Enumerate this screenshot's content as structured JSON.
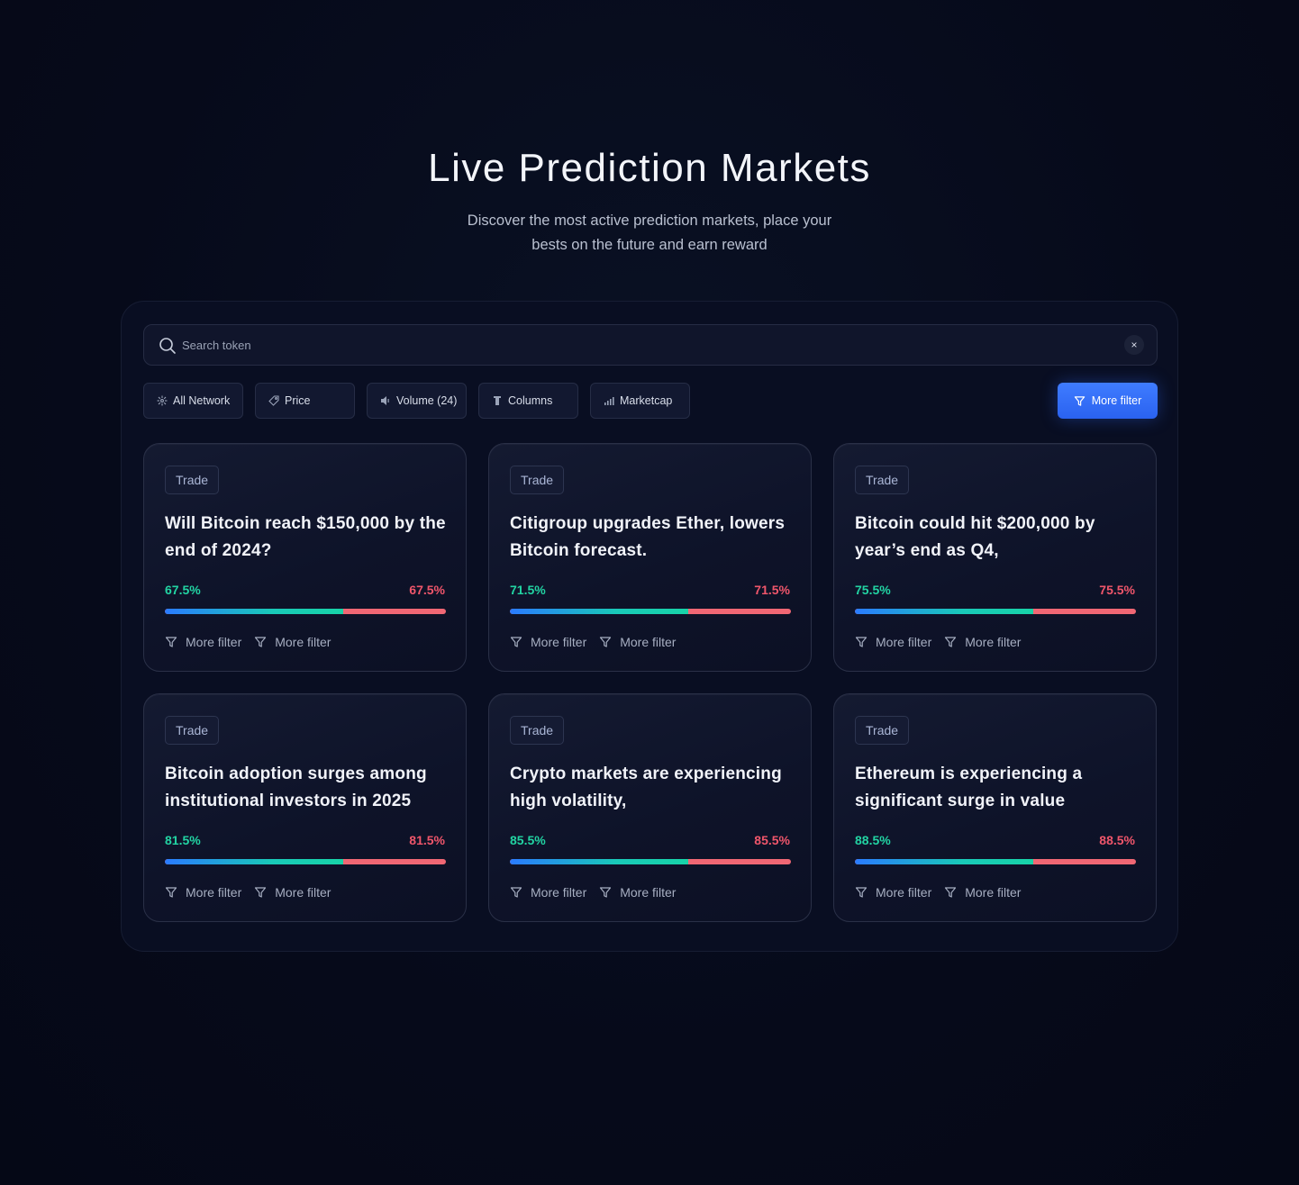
{
  "hero": {
    "title": "Live Prediction Markets",
    "subtitle_line1": "Discover the most active prediction markets, place your",
    "subtitle_line2": "bests on the future and earn reward"
  },
  "search": {
    "placeholder": "Search token",
    "value": "",
    "clear_label": "×"
  },
  "filters": {
    "chips": [
      {
        "label": "All Network",
        "icon": "network-icon"
      },
      {
        "label": "Price",
        "icon": "price-tag-icon"
      },
      {
        "label": "Volume (24)",
        "icon": "volume-icon"
      },
      {
        "label": "Columns",
        "icon": "columns-icon"
      },
      {
        "label": "Marketcap",
        "icon": "bar-chart-icon"
      }
    ],
    "more_filter": {
      "label": "More filter",
      "icon": "filter-icon"
    }
  },
  "colors": {
    "accent": "#2f6bff",
    "yes": "#22d4a3",
    "no": "#f0566b",
    "background": "#060a1a"
  },
  "cards": [
    {
      "badge": "Trade",
      "title": "Will Bitcoin reach $150,000 by the end of 2024?",
      "yes_pct": "67.5%",
      "no_pct": "67.5%",
      "fill": 0.635,
      "action1": "More filter",
      "action2": "More filter"
    },
    {
      "badge": "Trade",
      "title": "Citigroup upgrades Ether, lowers Bitcoin forecast.",
      "yes_pct": "71.5%",
      "no_pct": "71.5%",
      "fill": 0.635,
      "action1": "More filter",
      "action2": "More filter"
    },
    {
      "badge": "Trade",
      "title": "Bitcoin could hit $200,000 by year’s end as Q4,",
      "yes_pct": "75.5%",
      "no_pct": "75.5%",
      "fill": 0.635,
      "action1": "More filter",
      "action2": "More filter"
    },
    {
      "badge": "Trade",
      "title": "Bitcoin adoption surges among institutional investors in 2025",
      "yes_pct": "81.5%",
      "no_pct": "81.5%",
      "fill": 0.635,
      "action1": "More filter",
      "action2": "More filter"
    },
    {
      "badge": "Trade",
      "title": "Crypto markets are experiencing high volatility,",
      "yes_pct": "85.5%",
      "no_pct": "85.5%",
      "fill": 0.635,
      "action1": "More filter",
      "action2": "More filter"
    },
    {
      "badge": "Trade",
      "title": "Ethereum is experiencing a significant surge in value",
      "yes_pct": "88.5%",
      "no_pct": "88.5%",
      "fill": 0.635,
      "action1": "More filter",
      "action2": "More filter"
    }
  ]
}
